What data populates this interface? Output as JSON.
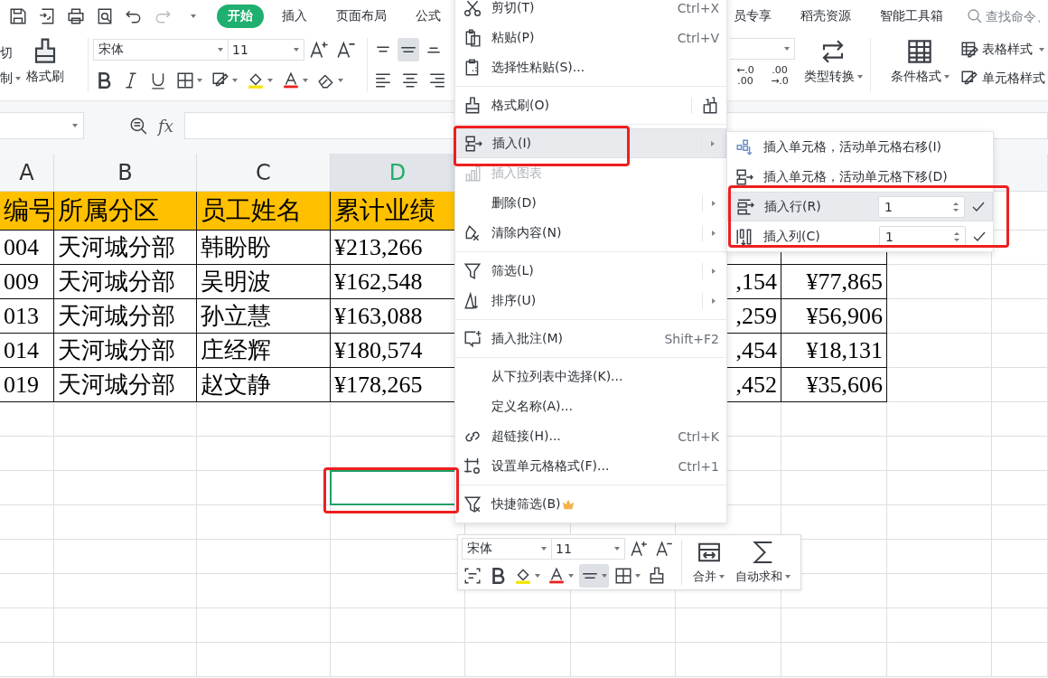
{
  "tabs": [
    {
      "label": "开始",
      "selected": true
    },
    {
      "label": "插入",
      "selected": false
    },
    {
      "label": "页面布局",
      "selected": false
    },
    {
      "label": "公式",
      "selected": false
    },
    {
      "label": "员专享",
      "selected": false
    },
    {
      "label": "稻壳资源",
      "selected": false
    },
    {
      "label": "智能工具箱",
      "selected": false
    }
  ],
  "search": {
    "placeholder": "查找命令、"
  },
  "ribbon": {
    "cut_label": "切",
    "copy_label": "制",
    "format_painter_label": "格式刷",
    "font_family": "宋体",
    "font_size": "11",
    "decimal_buttons": [
      {
        "top": "←.0",
        "bottom": ".00"
      },
      {
        "top": ".00",
        "bottom": "→.0"
      }
    ],
    "type_convert_label": "类型转换",
    "conditional_format_label": "条件格式",
    "table_style_label": "表格样式",
    "cell_style_label": "单元格样式"
  },
  "formula_bar": {
    "function_label": "fx"
  },
  "sheet": {
    "columns": [
      {
        "label": "A",
        "selected": false
      },
      {
        "label": "B",
        "selected": false
      },
      {
        "label": "C",
        "selected": false
      },
      {
        "label": "D",
        "selected": true
      }
    ],
    "header_row": [
      "编号",
      "所属分区",
      "员工姓名",
      "累计业绩"
    ],
    "rows": [
      {
        "cells": [
          "004",
          "天河城分部",
          "韩盼盼",
          "¥213,266"
        ]
      },
      {
        "cells": [
          "009",
          "天河城分部",
          "吴明波",
          "¥162,548",
          ",154",
          "¥77,865"
        ]
      },
      {
        "cells": [
          "013",
          "天河城分部",
          "孙立慧",
          "¥163,088",
          ",259",
          "¥56,906"
        ]
      },
      {
        "cells": [
          "014",
          "天河城分部",
          "庄经辉",
          "¥180,574",
          ",454",
          "¥18,131"
        ]
      },
      {
        "cells": [
          "019",
          "天河城分部",
          "赵文静",
          "¥178,265",
          ",452",
          "¥35,606"
        ]
      }
    ]
  },
  "context_menu": {
    "items": [
      {
        "kind": "item",
        "label": "剪切(T)",
        "shortcut": "Ctrl+X",
        "has_submenu": false,
        "disabled": false,
        "selected": false
      },
      {
        "kind": "item",
        "label": "粘贴(P)",
        "shortcut": "Ctrl+V",
        "has_submenu": false,
        "disabled": false,
        "selected": false
      },
      {
        "kind": "item",
        "label": "选择性粘贴(S)...",
        "has_submenu": false,
        "disabled": false,
        "selected": false
      },
      {
        "kind": "separator"
      },
      {
        "kind": "item",
        "label": "格式刷(O)",
        "has_submenu": false,
        "disabled": false,
        "selected": false
      },
      {
        "kind": "separator"
      },
      {
        "kind": "item",
        "label": "插入(I)",
        "has_submenu": true,
        "disabled": false,
        "selected": true
      },
      {
        "kind": "item",
        "label": "插入图表",
        "has_submenu": false,
        "disabled": true,
        "selected": false
      },
      {
        "kind": "item",
        "label": "删除(D)",
        "has_submenu": true,
        "disabled": false,
        "selected": false
      },
      {
        "kind": "item",
        "label": "清除内容(N)",
        "has_submenu": true,
        "disabled": false,
        "selected": false
      },
      {
        "kind": "separator"
      },
      {
        "kind": "item",
        "label": "筛选(L)",
        "has_submenu": true,
        "disabled": false,
        "selected": false
      },
      {
        "kind": "item",
        "label": "排序(U)",
        "has_submenu": true,
        "disabled": false,
        "selected": false
      },
      {
        "kind": "separator"
      },
      {
        "kind": "item",
        "label": "插入批注(M)",
        "shortcut": "Shift+F2",
        "has_submenu": false,
        "disabled": false,
        "selected": false
      },
      {
        "kind": "separator"
      },
      {
        "kind": "item",
        "label": "从下拉列表中选择(K)...",
        "has_submenu": false,
        "disabled": false,
        "selected": false
      },
      {
        "kind": "item",
        "label": "定义名称(A)...",
        "has_submenu": false,
        "disabled": false,
        "selected": false
      },
      {
        "kind": "item",
        "label": "超链接(H)...",
        "shortcut": "Ctrl+K",
        "has_submenu": false,
        "disabled": false,
        "selected": false
      },
      {
        "kind": "item",
        "label": "设置单元格格式(F)...",
        "shortcut": "Ctrl+1",
        "has_submenu": false,
        "disabled": false,
        "selected": false
      },
      {
        "kind": "separator"
      },
      {
        "kind": "item",
        "label": "快捷筛选(B)",
        "has_submenu": false,
        "disabled": false,
        "selected": false
      }
    ]
  },
  "submenu": {
    "items": [
      {
        "kind": "plain",
        "label": "插入单元格，活动单元格右移(I)",
        "selected": false
      },
      {
        "kind": "plain",
        "label": "插入单元格，活动单元格下移(D)",
        "selected": false
      },
      {
        "kind": "count",
        "label": "插入行(R)",
        "value": "1",
        "selected": true
      },
      {
        "kind": "count",
        "label": "插入列(C)",
        "value": "1",
        "selected": false
      }
    ]
  },
  "mini_toolbar": {
    "font_family": "宋体",
    "font_size": "11",
    "merge_label": "合并",
    "autosum_label": "自动求和"
  }
}
